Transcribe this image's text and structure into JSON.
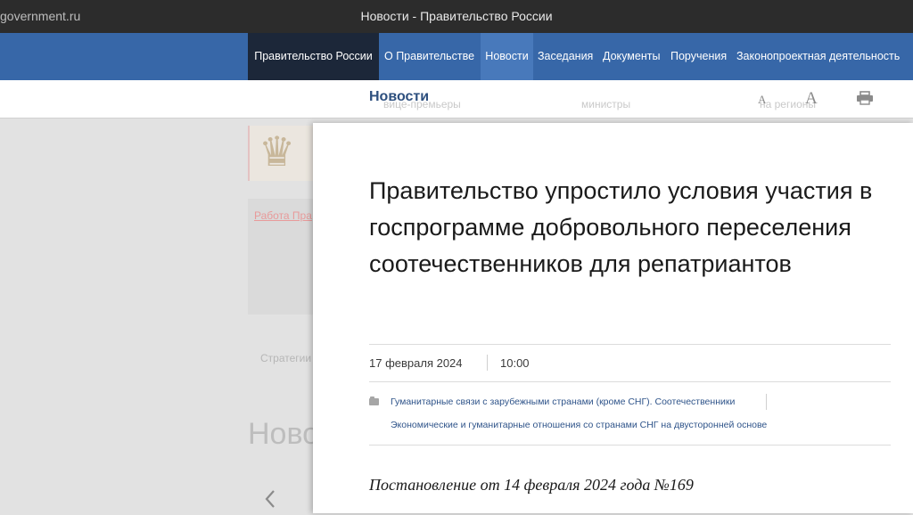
{
  "window": {
    "url": "government.ru",
    "title": "Новости - Правительство России"
  },
  "nav": {
    "items": [
      {
        "label": "Правительство России"
      },
      {
        "label": "О Правительстве"
      },
      {
        "label": "Новости"
      },
      {
        "label": "Заседания"
      },
      {
        "label": "Документы"
      },
      {
        "label": "Поручения"
      },
      {
        "label": "Законопроектная деятельность"
      }
    ]
  },
  "subheader": {
    "title": "Новости",
    "ghost_items": [
      "вице-премьеры",
      "министры",
      "на регионы"
    ],
    "tools": {
      "font_small": "A",
      "font_large": "A",
      "print_icon": "printer-icon"
    }
  },
  "background": {
    "work_link": "Работа Пра",
    "strategy": "Стратегии",
    "news_heading": "Ново",
    "arrow_icon": "chevron-left-icon"
  },
  "article": {
    "title": "Правительство упростило условия участия в госпрограмме добровольного переселения соотечественников для репатриантов",
    "date": "17 февраля 2024",
    "time": "10:00",
    "tags": [
      "Гуманитарные связи с зарубежными странами (кроме СНГ). Соотечественники",
      "Экономические и гуманитарные отношения со странами СНГ на двусторонней основе"
    ],
    "decree": "Постановление от 14 февраля 2024 года №169",
    "tag_icon": "folder-icon"
  },
  "colors": {
    "nav_bg": "#3767a8",
    "nav_dark": "#1c2739",
    "nav_active": "#4879bb",
    "link": "#2f548a"
  }
}
